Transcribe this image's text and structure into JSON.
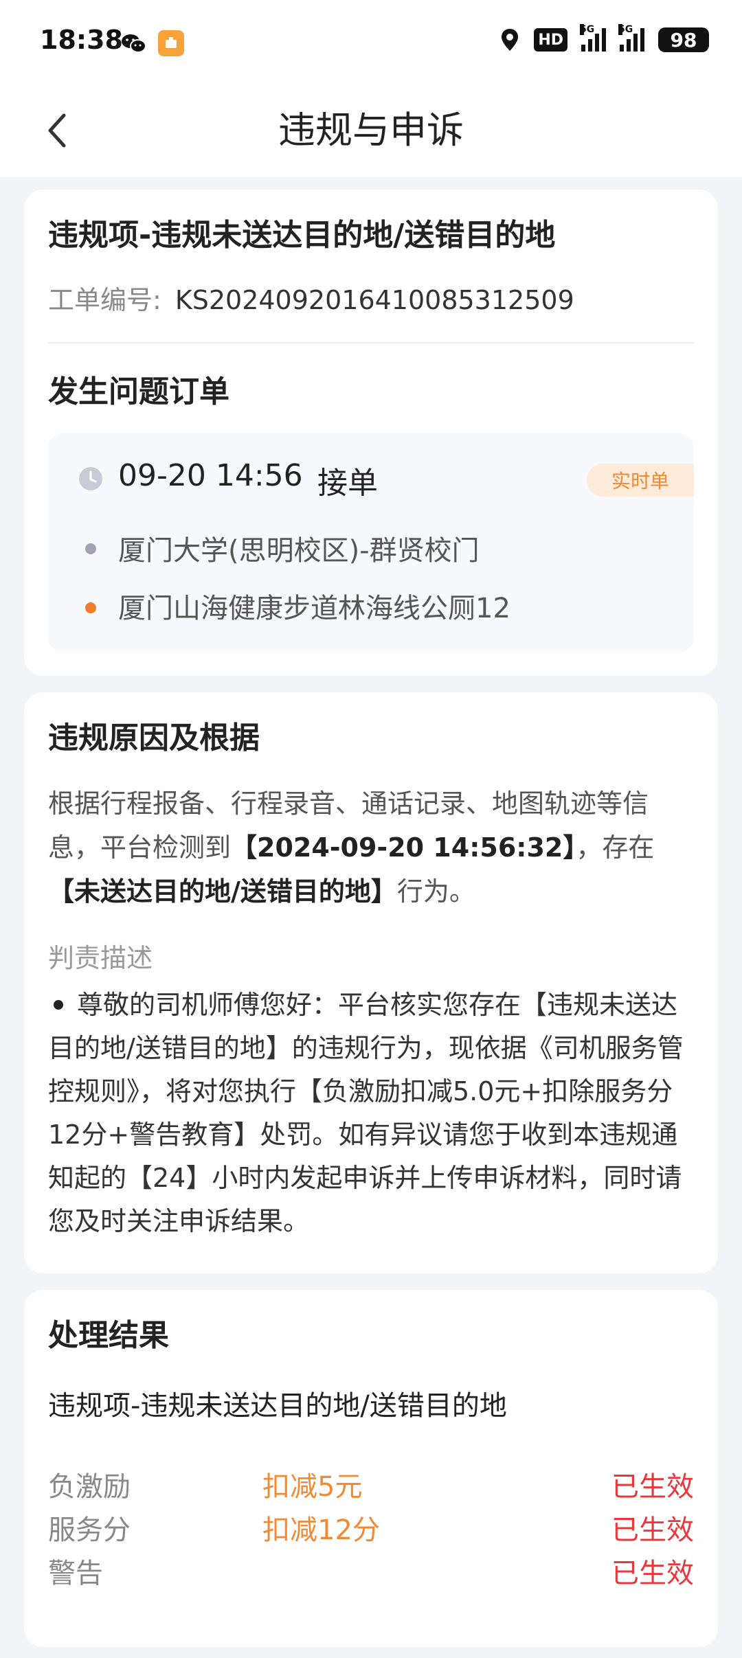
{
  "status_bar": {
    "time": "18:38",
    "hd_label": "HD",
    "network_label": "5G",
    "battery": "98"
  },
  "header": {
    "title": "违规与申诉"
  },
  "violation": {
    "title": "违规项-违规未送达目的地/送错目的地",
    "order_no_label": "工单编号:",
    "order_no": "KS20240920164100853125​09"
  },
  "issue_order": {
    "section_title": "发生问题订单",
    "time": "09-20 14:56",
    "status": "接单",
    "tag": "实时单",
    "start_address": "厦门大学(思明校区)-群贤校门",
    "end_address": "厦门山海健康步道林海线公厕12"
  },
  "reason": {
    "section_title": "违规原因及根据",
    "text_part1": "根据行程报备、行程录音、通话记录、地图轨迹等信息，平台检测到",
    "bold_time": "【2024-09-20 14:56:32】",
    "text_part2": "，存在",
    "bold_behavior": "【未送达目的地/送错目的地】",
    "text_part3": "行为。",
    "judge_label": "判责描述",
    "judge_text": "尊敬的司机师傅您好：平台核实您存在【违规未送达目的地/送错目的地】的违规行为，现依据《司机服务管控规则》，将对您执行【负激励扣减5.0元+扣除服务分12分+警告教育】处罚。如有异议请您于收到本违规通知起的【24】小时内发起申诉并上传申诉材料，同时请您及时关注申诉结果。"
  },
  "result": {
    "section_title": "处理结果",
    "subtitle": "违规项-违规未送达目的地/送错目的地",
    "rows": [
      {
        "name": "负激励",
        "value": "扣减5元",
        "state": "已生效"
      },
      {
        "name": "服务分",
        "value": "扣减12分",
        "state": "已生效"
      },
      {
        "name": "警告",
        "value": "",
        "state": "已生效"
      }
    ]
  }
}
